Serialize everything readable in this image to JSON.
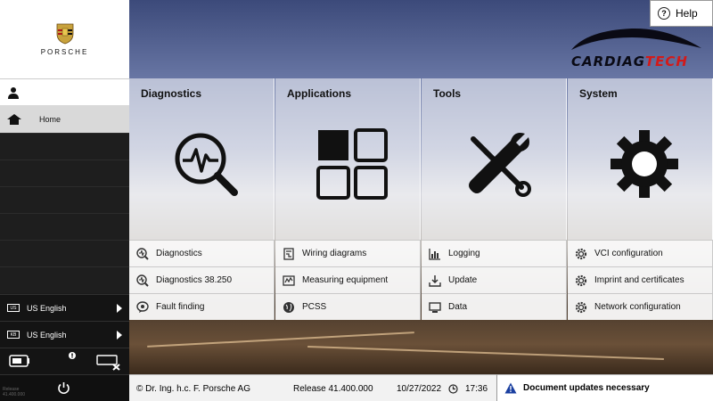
{
  "brand": {
    "wordmark": "PORSCHE",
    "watermark_left": "CARDIAG",
    "watermark_right": "TECH"
  },
  "help": {
    "label": "Help"
  },
  "sidebar": {
    "home_label": "Home",
    "lang1": {
      "badge": "US",
      "label": "US English"
    },
    "lang2": {
      "badge": "KB",
      "label": "US English"
    },
    "release_small": "Release\n41.400.000"
  },
  "columns": [
    {
      "title": "Diagnostics",
      "items": [
        "Diagnostics",
        "Diagnostics 38.250",
        "Fault finding"
      ]
    },
    {
      "title": "Applications",
      "items": [
        "Wiring diagrams",
        "Measuring equipment",
        "PCSS"
      ]
    },
    {
      "title": "Tools",
      "items": [
        "Logging",
        "Update",
        "Data"
      ]
    },
    {
      "title": "System",
      "items": [
        "VCI configuration",
        "Imprint and certificates",
        "Network configuration"
      ]
    }
  ],
  "footer": {
    "copyright": "© Dr. Ing. h.c. F. Porsche AG",
    "release": "Release 41.400.000",
    "date": "10/27/2022",
    "time": "17:36",
    "doc_updates": "Document updates necessary"
  },
  "colors": {
    "accent_red": "#d21a1a",
    "warning_blue": "#1a3fa0"
  }
}
